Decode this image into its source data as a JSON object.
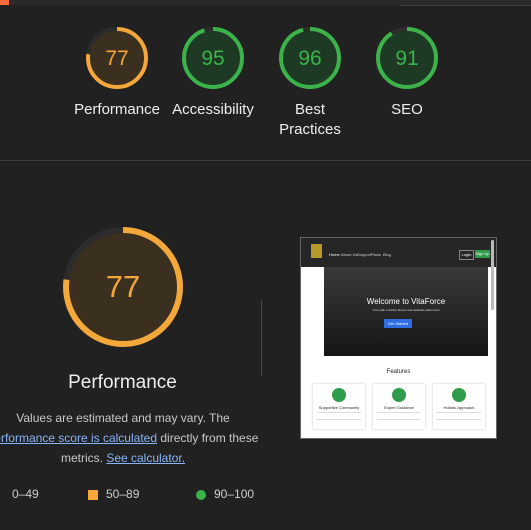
{
  "top_categories": [
    {
      "label": "Performance",
      "score": 77,
      "status": "average"
    },
    {
      "label": "Accessibility",
      "score": 95,
      "status": "pass"
    },
    {
      "label": "Best Practices",
      "score": 96,
      "status": "pass"
    },
    {
      "label": "SEO",
      "score": 91,
      "status": "pass"
    }
  ],
  "main_gauge": {
    "score": 77,
    "title": "Performance",
    "status": "average"
  },
  "note": {
    "text1": "Values are estimated and may vary. The",
    "link1": "performance score is calculated",
    "text2": "directly from these",
    "text3": "metrics.",
    "link2": "See calculator."
  },
  "legend": [
    {
      "range": "0–49",
      "shape": "triangle",
      "color": "#ff4e42"
    },
    {
      "range": "50–89",
      "shape": "square",
      "color": "#f5a83a"
    },
    {
      "range": "90–100",
      "shape": "circle",
      "color": "#3bb34a"
    }
  ],
  "colors": {
    "average_stroke": "#f5a83a",
    "average_bg": "#3b2f1f",
    "average_text": "#f5a83a",
    "pass_stroke": "#3bb34a",
    "pass_bg": "#1f3a24",
    "pass_text": "#3bb34a",
    "track": "#2c2c2c"
  },
  "screenshot": {
    "nav_links": [
      "Home",
      "About Us",
      "Support",
      "Plans",
      "Blog"
    ],
    "login": "Login",
    "signup": "Sign Up",
    "hero_title": "Welcome to VitaForce",
    "hero_subtitle": "Your path to better fitness and wellness starts here",
    "hero_button": "Get Started",
    "features_title": "Features",
    "features": [
      "Supportive Community",
      "Expert Guidance",
      "Holistic Approach"
    ]
  }
}
